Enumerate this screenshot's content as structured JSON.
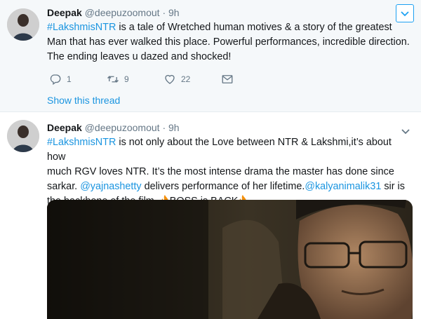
{
  "tweets": [
    {
      "author": {
        "name": "Deepak",
        "handle": "@deepuzoomout",
        "separator": "·",
        "time": "9h"
      },
      "body": {
        "hashtag": "#LakshmisNTR",
        "line1_rest": " is a tale of Wretched human motives & a story of the greatest",
        "line2": "Man that has ever walked  this place. Powerful performances, incredible direction.",
        "line3": "The ending leaves u dazed and shocked!"
      },
      "actions": {
        "reply_icon": "reply-icon",
        "replies": "1",
        "retweet_icon": "retweet-icon",
        "retweets": "9",
        "like_icon": "heart-icon",
        "likes": "22",
        "dm_icon": "envelope-icon"
      },
      "show_thread": "Show this thread",
      "menu_icon": "chevron-down-icon"
    },
    {
      "author": {
        "name": "Deepak",
        "handle": "@deepuzoomout",
        "separator": "·",
        "time": "9h"
      },
      "body": {
        "hashtag": "#LakshmisNTR",
        "line1_rest": " is not only about the Love between NTR & Lakshmi,it’s about how",
        "line2": "much RGV loves NTR. It’s the most intense drama the master has done since",
        "line3_a": "sarkar. ",
        "mention1": "@yajnashetty",
        "line3_b": " delivers performance of her lifetime.",
        "mention2": "@kalyanimalik31",
        "line3_c": " sir is",
        "line4_a": "the backbone of the film. ",
        "line4_b": "BOSS is BACK",
        "fire_icon": "fire-emoji-icon"
      },
      "menu_icon": "chevron-down-icon"
    }
  ],
  "colors": {
    "link": "#1b95e0",
    "text": "#14171a",
    "muted": "#657786",
    "highlight_bg": "#f5f8fa",
    "accent": "#1da1f2"
  }
}
